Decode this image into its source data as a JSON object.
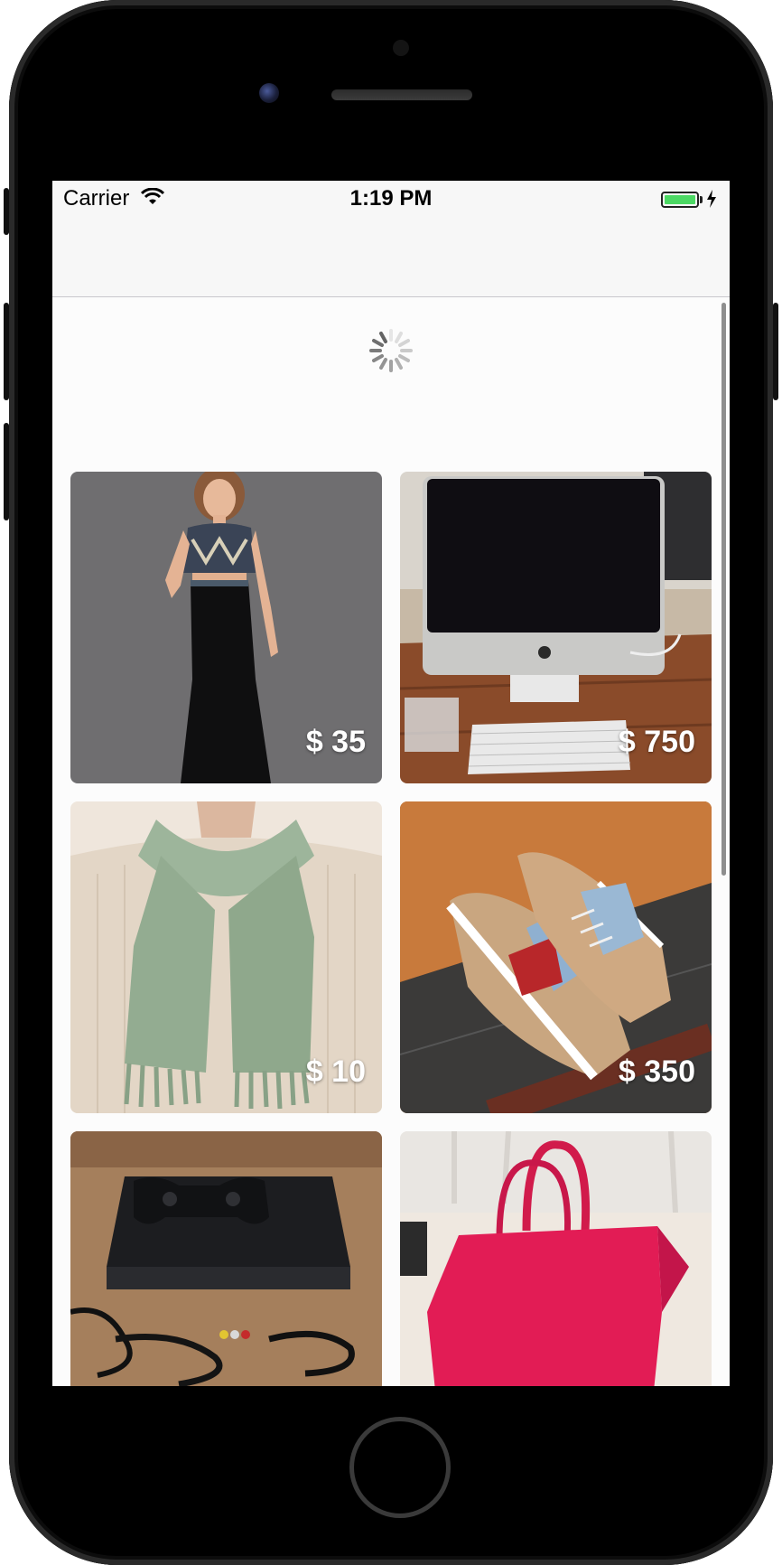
{
  "status_bar": {
    "carrier": "Carrier",
    "time": "1:19 PM",
    "battery_color": "#4cd964"
  },
  "navigation": {
    "title": ""
  },
  "feed": {
    "loading": true,
    "items": [
      {
        "name": "two-piece-dress",
        "price": "$ 35"
      },
      {
        "name": "imac-desktop",
        "price": "$ 750"
      },
      {
        "name": "green-scarf",
        "price": "$ 10"
      },
      {
        "name": "sneakers",
        "price": "$ 350"
      },
      {
        "name": "game-console",
        "price": ""
      },
      {
        "name": "red-handbag",
        "price": ""
      }
    ]
  }
}
